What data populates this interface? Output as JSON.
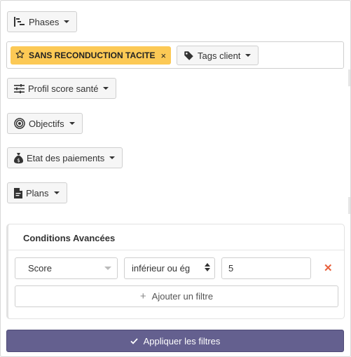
{
  "filters": {
    "phases": {
      "label": "Phases"
    },
    "tags": {
      "active_tag": "SANS RECONDUCTION TACITE",
      "remove_symbol": "×",
      "label": "Tags client"
    },
    "health_profile": {
      "label": "Profil score santé"
    },
    "objectives": {
      "label": "Objectifs"
    },
    "payments": {
      "label": "Etat des paiements"
    },
    "plans": {
      "label": "Plans"
    }
  },
  "advanced": {
    "title": "Conditions Avancées",
    "field_select": "Score",
    "operator_select": "inférieur ou ég",
    "value": "5",
    "remove_symbol": "✕",
    "add_filter_label": "Ajouter un filtre"
  },
  "apply_label": "Appliquer les filtres",
  "colors": {
    "tag_chip": "#fcc955",
    "apply_button": "#64608f",
    "remove_condition": "#e8603c"
  }
}
